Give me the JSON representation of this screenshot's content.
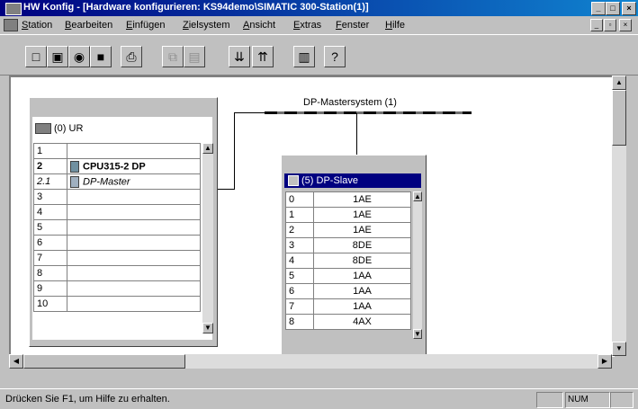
{
  "window": {
    "title": "HW Konfig - [Hardware konfigurieren: KS94demo\\SIMATIC 300-Station(1)]"
  },
  "menu": [
    "Station",
    "Bearbeiten",
    "Einfügen",
    "Zielsystem",
    "Ansicht",
    "Extras",
    "Fenster",
    "Hilfe"
  ],
  "toolbar": {
    "icons": [
      "new-icon",
      "open-icon",
      "network-icon",
      "save-icon",
      "print-icon",
      "copy-icon",
      "paste-icon",
      "download-icon",
      "upload-icon",
      "catalog-icon",
      "help-icon"
    ]
  },
  "dp_master_system": {
    "label": "DP-Mastersystem (1)"
  },
  "ur_rack": {
    "title": "(0) UR",
    "rows": [
      {
        "slot": "1",
        "module": ""
      },
      {
        "slot": "2",
        "module": "CPU315-2 DP"
      },
      {
        "slot": "2.1",
        "module": "DP-Master"
      },
      {
        "slot": "3",
        "module": ""
      },
      {
        "slot": "4",
        "module": ""
      },
      {
        "slot": "5",
        "module": ""
      },
      {
        "slot": "6",
        "module": ""
      },
      {
        "slot": "7",
        "module": ""
      },
      {
        "slot": "8",
        "module": ""
      },
      {
        "slot": "9",
        "module": ""
      },
      {
        "slot": "10",
        "module": ""
      }
    ]
  },
  "dp_slave": {
    "title": "(5) DP-Slave",
    "rows": [
      {
        "slot": "0",
        "module": "1AE"
      },
      {
        "slot": "1",
        "module": "1AE"
      },
      {
        "slot": "2",
        "module": "1AE"
      },
      {
        "slot": "3",
        "module": "8DE"
      },
      {
        "slot": "4",
        "module": "8DE"
      },
      {
        "slot": "5",
        "module": "1AA"
      },
      {
        "slot": "6",
        "module": "1AA"
      },
      {
        "slot": "7",
        "module": "1AA"
      },
      {
        "slot": "8",
        "module": "4AX"
      }
    ]
  },
  "status": {
    "text": "Drücken Sie F1, um Hilfe zu erhalten.",
    "num": "NUM"
  }
}
